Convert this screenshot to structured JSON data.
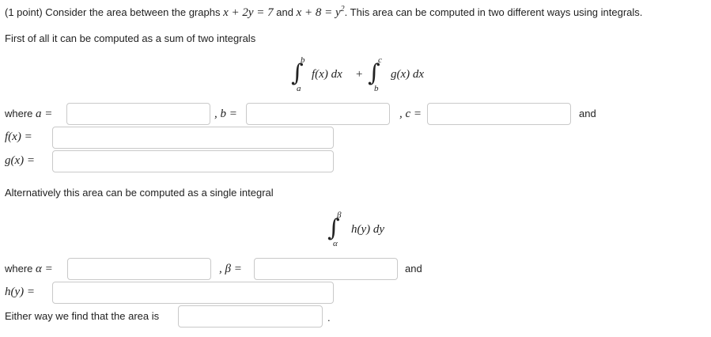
{
  "problem": {
    "prefix": "(1 point) Consider the area between the graphs",
    "eq1": "x + 2y = 7",
    "and": "and",
    "eq2_base": "x + 8 = y",
    "eq2_exp": "2",
    "suffix": ". This area can be computed in two different ways using integrals."
  },
  "part1": {
    "intro": "First of all it can be computed as a sum of two integrals",
    "integral1": {
      "upper": "b",
      "lower": "a",
      "integrand": "f(x) dx"
    },
    "plus": "+",
    "integral2": {
      "upper": "c",
      "lower": "b",
      "integrand": "g(x) dx"
    },
    "where_label": "where",
    "a_label": "a =",
    "b_label": ", b =",
    "c_label": ", c =",
    "and_label": "and",
    "f_label": "f(x) =",
    "g_label": "g(x) =",
    "a_value": "",
    "b_value": "",
    "c_value": "",
    "f_value": "",
    "g_value": ""
  },
  "part2": {
    "intro": "Alternatively this area can be computed as a single integral",
    "integral": {
      "upper": "β",
      "lower": "α",
      "integrand": "h(y) dy"
    },
    "where_label": "where",
    "alpha_label": "α =",
    "beta_label": ", β =",
    "and_label": "and",
    "h_label": "h(y) =",
    "alpha_value": "",
    "beta_value": "",
    "h_value": ""
  },
  "final": {
    "text": "Either way we find that the area is",
    "period": ".",
    "area_value": ""
  }
}
